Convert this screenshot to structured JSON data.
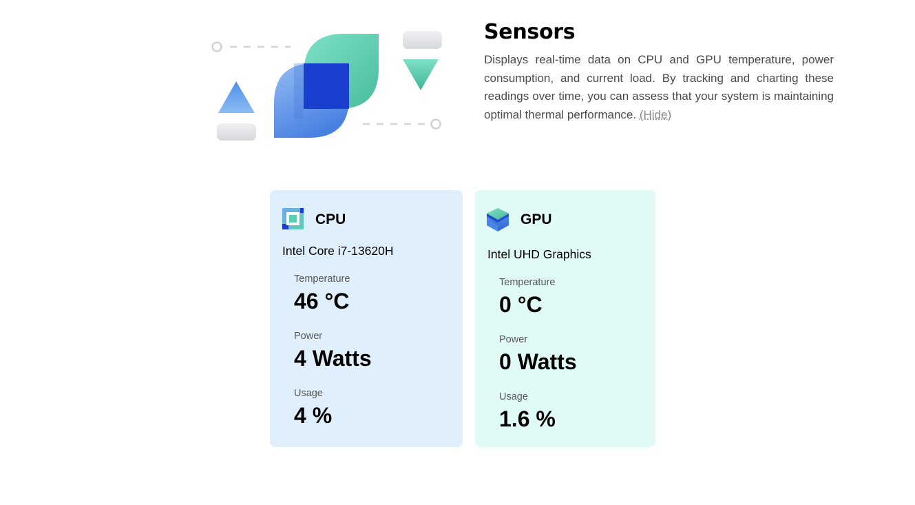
{
  "header": {
    "title": "Sensors",
    "description": "Displays real-time data on CPU and GPU temperature, power consumption, and current load. By tracking and charting these readings over time, you can assess that your system is maintaining optimal thermal performance.",
    "hide_link": "(Hide)"
  },
  "cards": {
    "cpu": {
      "title": "CPU",
      "icon": "cpu-icon",
      "device": "Intel Core i7-13620H",
      "temperature_label": "Temperature",
      "temperature_value": "46 °C",
      "power_label": "Power",
      "power_value": "4 Watts",
      "usage_label": "Usage",
      "usage_value": "4 %"
    },
    "gpu": {
      "title": "GPU",
      "icon": "gpu-icon",
      "device": "Intel UHD Graphics",
      "temperature_label": "Temperature",
      "temperature_value": "0 °C",
      "power_label": "Power",
      "power_value": "0 Watts",
      "usage_label": "Usage",
      "usage_value": "1.6 %"
    }
  },
  "colors": {
    "cpu_card_bg": "#dff0fc",
    "gpu_card_bg": "#e0fbf6",
    "accent_blue": "#1b3fcc",
    "accent_teal": "#56c7ab"
  }
}
